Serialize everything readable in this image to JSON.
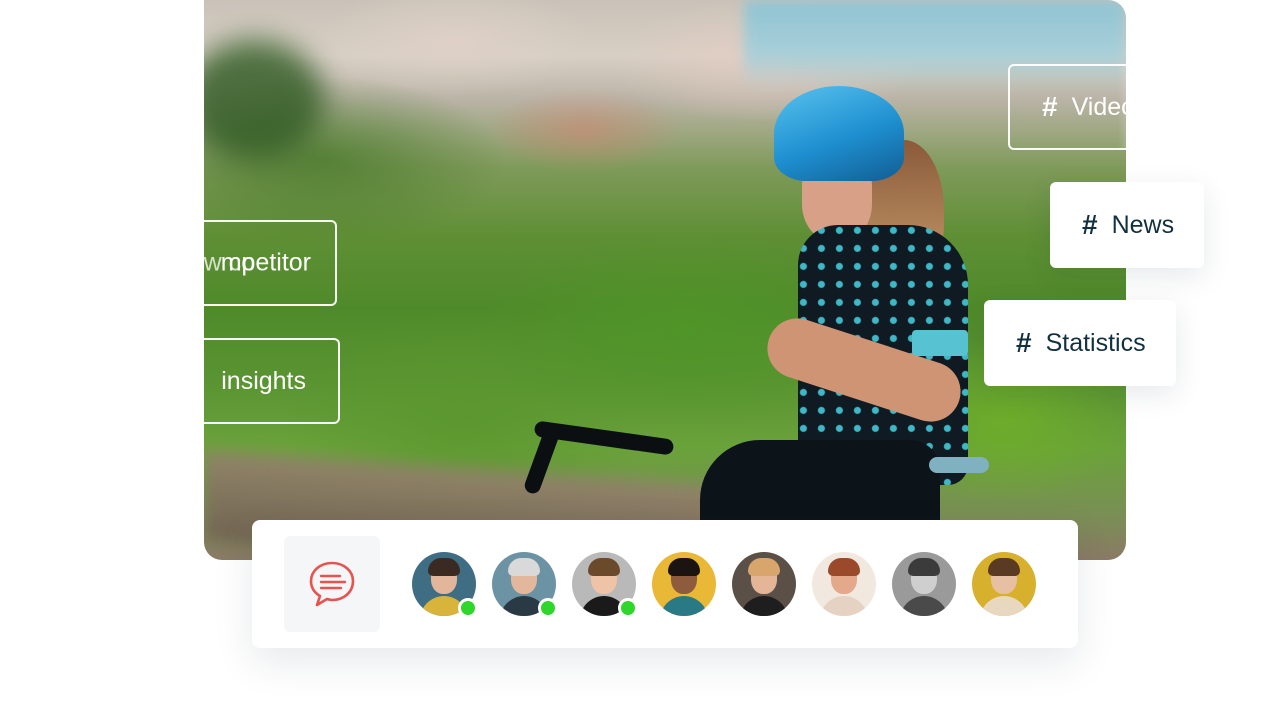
{
  "tags": {
    "video": {
      "hash": "#",
      "label": "Video"
    },
    "news": {
      "hash": "#",
      "label": "News"
    },
    "statistics": {
      "hash": "#",
      "label": "Statistics"
    }
  },
  "left_tags": {
    "competitor": {
      "faded_prefix": "New co",
      "visible_text": "mpetitor"
    },
    "insights": {
      "label": "insights"
    }
  },
  "people_bar": {
    "chat_icon": "chat-bubble-icon",
    "accent_color": "#e8524f",
    "online_color": "#2fd62b",
    "avatars": [
      {
        "name": "avatar-1",
        "bg": "#3f6e84",
        "skin": "#e2b69a",
        "hair": "#3a2a22",
        "shirt": "#d8b43a",
        "online": true
      },
      {
        "name": "avatar-2",
        "bg": "#6c93a3",
        "skin": "#e3b79b",
        "hair": "#d9d9d9",
        "shirt": "#2a3a44",
        "online": true
      },
      {
        "name": "avatar-3",
        "bg": "#b9b9b9",
        "skin": "#efc4a6",
        "hair": "#6b4a2c",
        "shirt": "#1a1a1a",
        "online": true
      },
      {
        "name": "avatar-4",
        "bg": "#e9b836",
        "skin": "#8e5b3d",
        "hair": "#1c1411",
        "shirt": "#2a7a86",
        "online": false
      },
      {
        "name": "avatar-5",
        "bg": "#5a5048",
        "skin": "#e4b596",
        "hair": "#d8a66c",
        "shirt": "#1e1e1e",
        "online": false
      },
      {
        "name": "avatar-6",
        "bg": "#f1e8e0",
        "skin": "#e4a98a",
        "hair": "#9a4a2a",
        "shirt": "#e6d2c3",
        "online": false
      },
      {
        "name": "avatar-7",
        "bg": "#9a9a9a",
        "skin": "#cfcfcf",
        "hair": "#3b3b3b",
        "shirt": "#4a4a4a",
        "online": false
      },
      {
        "name": "avatar-8",
        "bg": "#d7b02e",
        "skin": "#e7bfa2",
        "hair": "#5a3a22",
        "shirt": "#e8d8c0",
        "online": false
      }
    ]
  }
}
